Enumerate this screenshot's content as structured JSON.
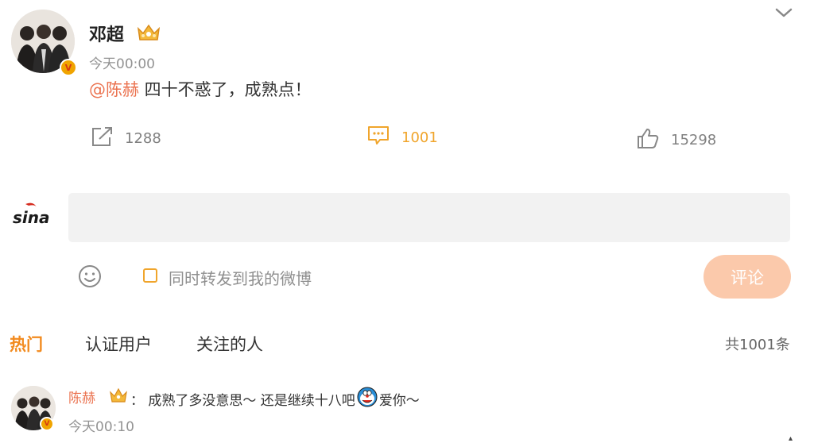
{
  "post": {
    "author": "邓超",
    "time": "今天00:00",
    "mention": "@陈赫",
    "text": " 四十不惑了，成熟点！",
    "reposts": "1288",
    "comments": "1001",
    "likes": "15298"
  },
  "composer": {
    "logo_text": "sina",
    "forward_label": "同时转发到我的微博",
    "submit_label": "评论"
  },
  "tabs": [
    {
      "label": "热门",
      "active": true
    },
    {
      "label": "认证用户",
      "active": false
    },
    {
      "label": "关注的人",
      "active": false
    }
  ],
  "comment_count": "共1001条",
  "comment": {
    "author": "陈赫",
    "text_part1": "： 成熟了多没意思～ 还是继续十八吧",
    "text_part2": " 爱你～",
    "time": "今天00:10"
  },
  "colors": {
    "accent": "#eb7350",
    "orange": "#f0a52c",
    "hot_tab": "#f28a1e",
    "button_bg": "#fbc9ab",
    "input_bg": "#f2f2f2"
  },
  "icons": [
    "chevron-down-icon",
    "share-icon",
    "comment-icon",
    "like-icon",
    "emoji-icon",
    "crown-icon",
    "doraemon-emoji-icon",
    "verified-badge-icon"
  ]
}
